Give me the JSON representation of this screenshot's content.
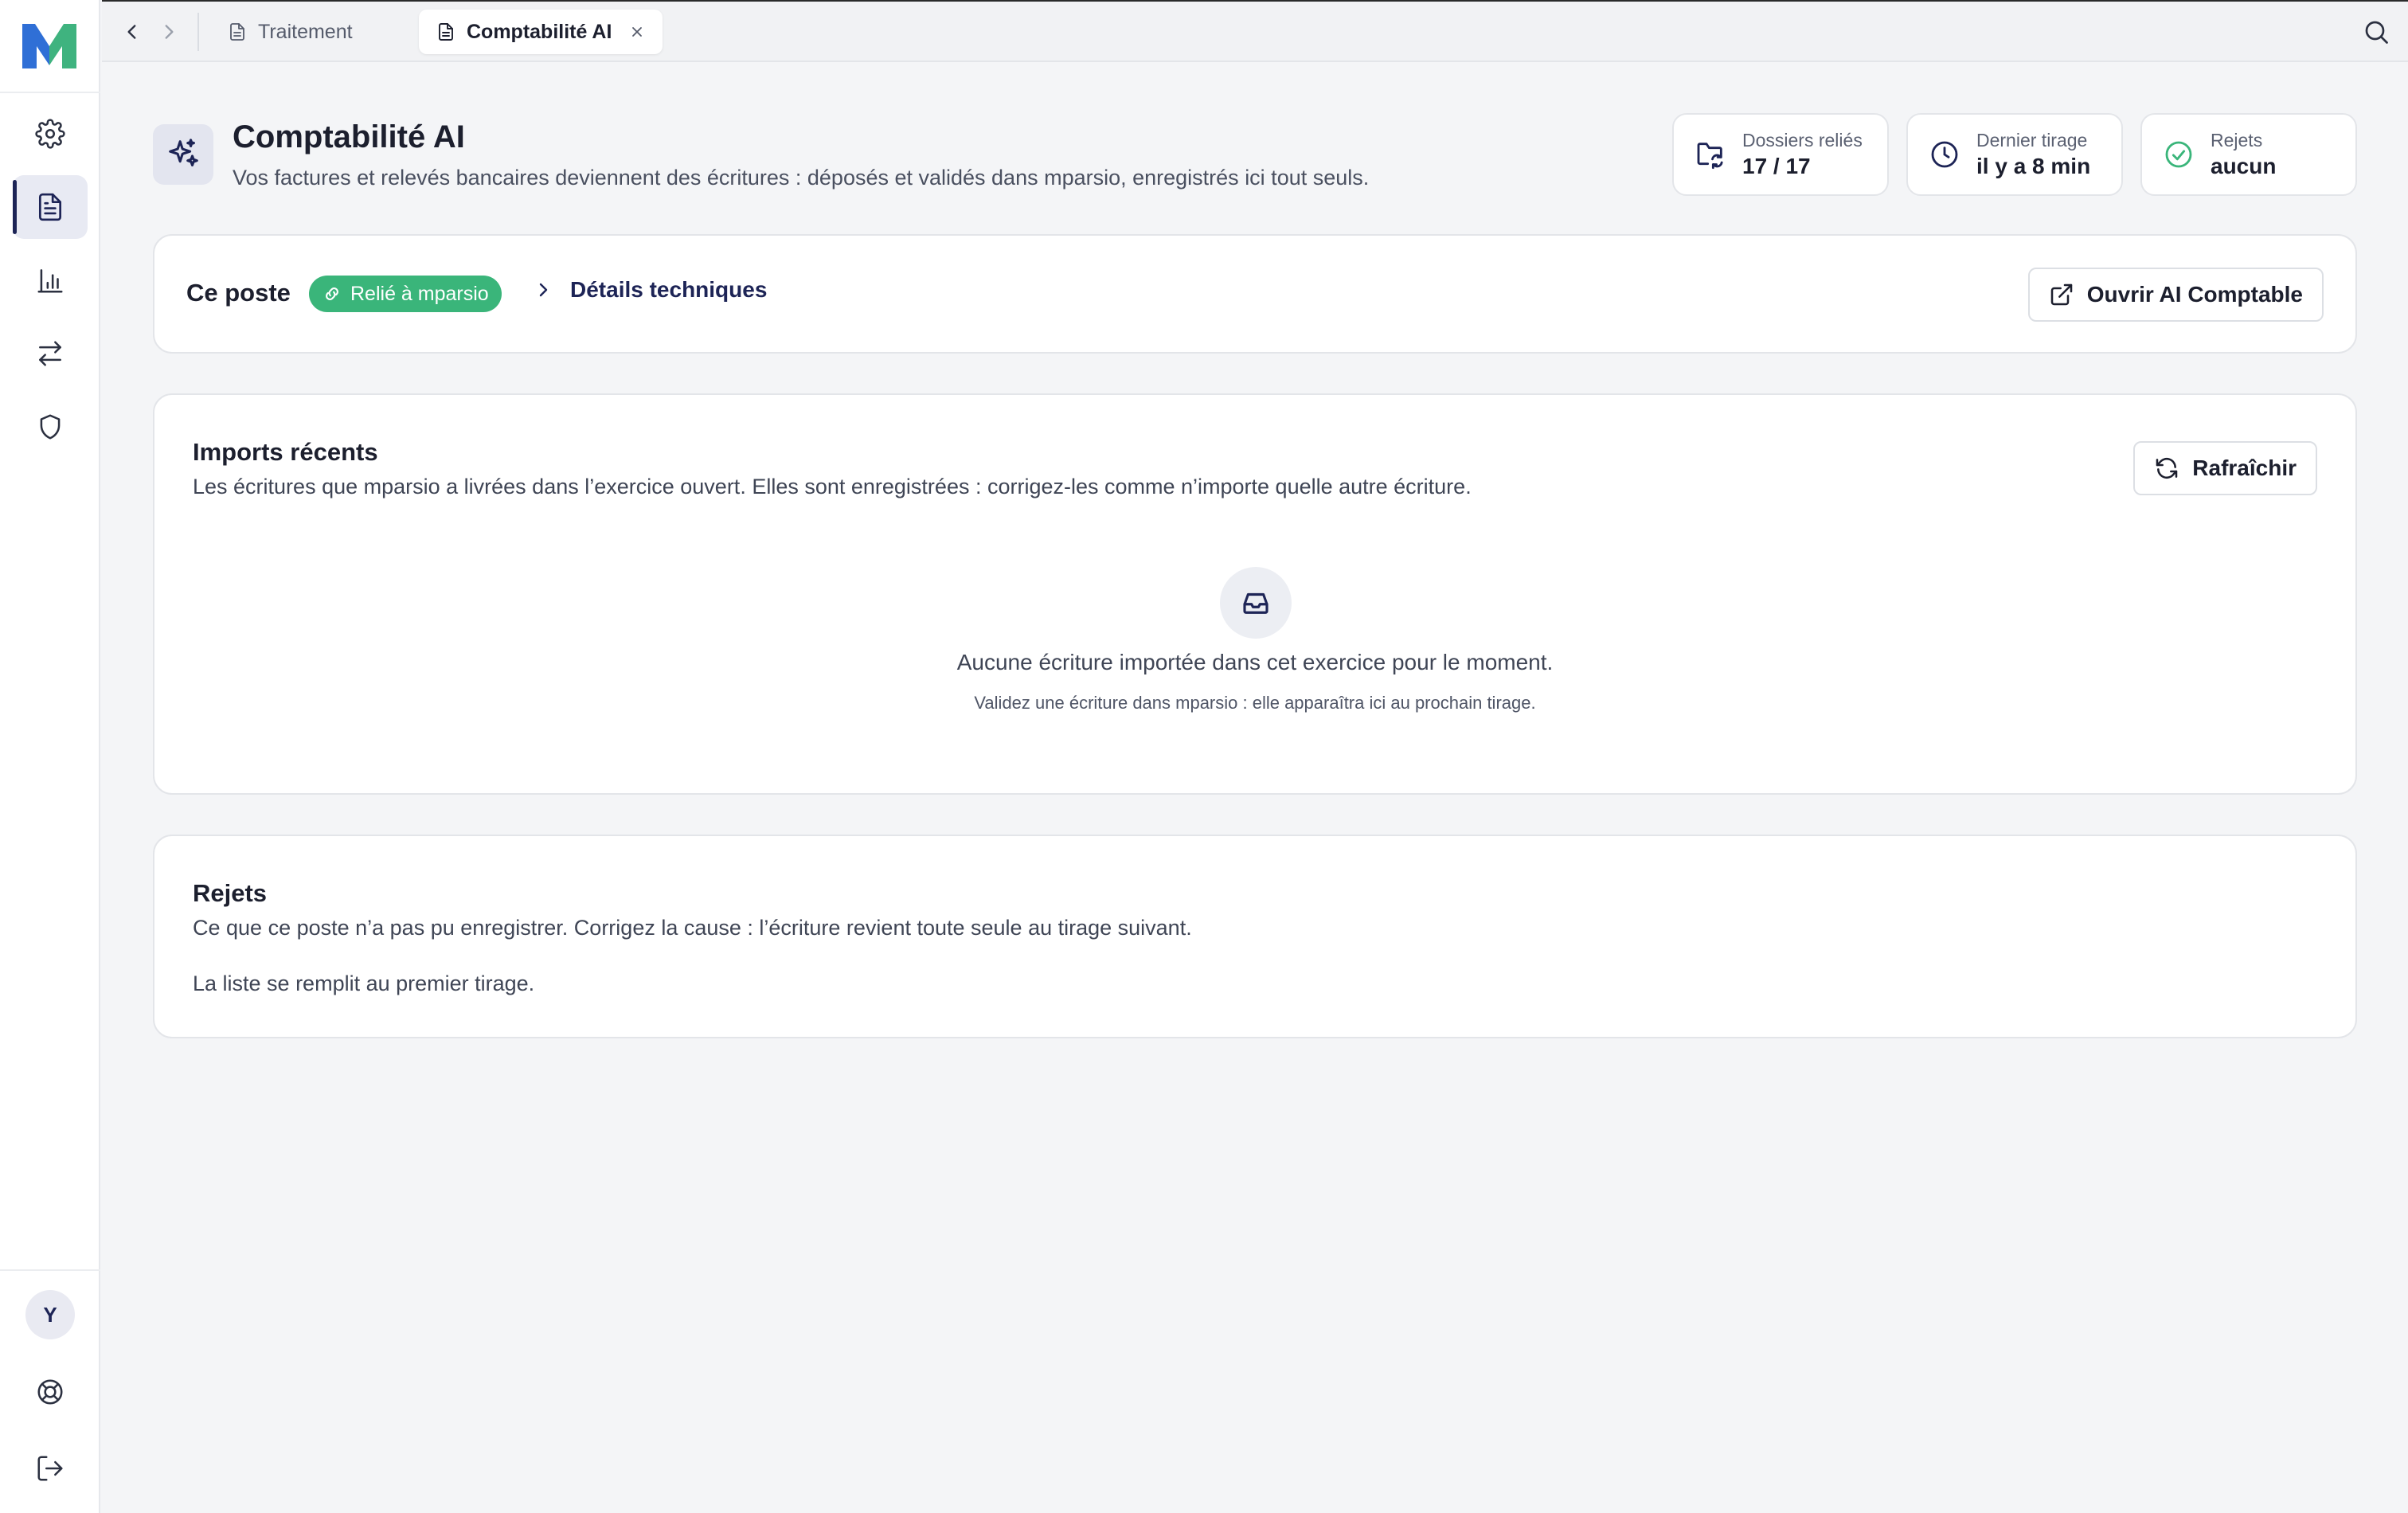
{
  "topbar": {
    "tabs": [
      {
        "label": "Traitement",
        "active": false
      },
      {
        "label": "Comptabilité AI",
        "active": true
      }
    ]
  },
  "header": {
    "title": "Comptabilité AI",
    "subtitle": "Vos factures et relevés bancaires deviennent des écritures : déposés et validés dans mparsio, enregistrés ici tout seuls."
  },
  "stats": [
    {
      "label": "Dossiers reliés",
      "value": "17 / 17",
      "icon": "folder-sync-icon"
    },
    {
      "label": "Dernier tirage",
      "value": "il y a 8 min",
      "icon": "clock-icon"
    },
    {
      "label": "Rejets",
      "value": "aucun",
      "icon": "check-circle-icon"
    }
  ],
  "poste": {
    "label": "Ce poste",
    "badge": "Relié à mparsio",
    "details_link": "Détails techniques",
    "open_button": "Ouvrir AI Comptable"
  },
  "imports": {
    "title": "Imports récents",
    "description": "Les écritures que mparsio a livrées dans l’exercice ouvert. Elles sont enregistrées : corrigez-les comme n’importe quelle autre écriture.",
    "refresh_button": "Rafraîchir",
    "empty_message": "Aucune écriture importée dans cet exercice pour le moment.",
    "empty_hint": "Validez une écriture dans mparsio : elle apparaîtra ici au prochain tirage."
  },
  "rejets": {
    "title": "Rejets",
    "description": "Ce que ce poste n’a pas pu enregistrer. Corrigez la cause : l’écriture revient toute seule au tirage suivant.",
    "empty_message": "La liste se remplit au premier tirage."
  },
  "sidebar": {
    "avatar_initial": "Y",
    "items": [
      "gear-icon",
      "document-icon",
      "bar-chart-icon",
      "arrows-swap-icon",
      "shield-icon"
    ],
    "active_item": "document-icon"
  },
  "colors": {
    "accent": "#1d2456",
    "badge_green": "#3ab57a",
    "logo_blue": "#2f6fd6",
    "logo_green": "#3fb37f"
  }
}
